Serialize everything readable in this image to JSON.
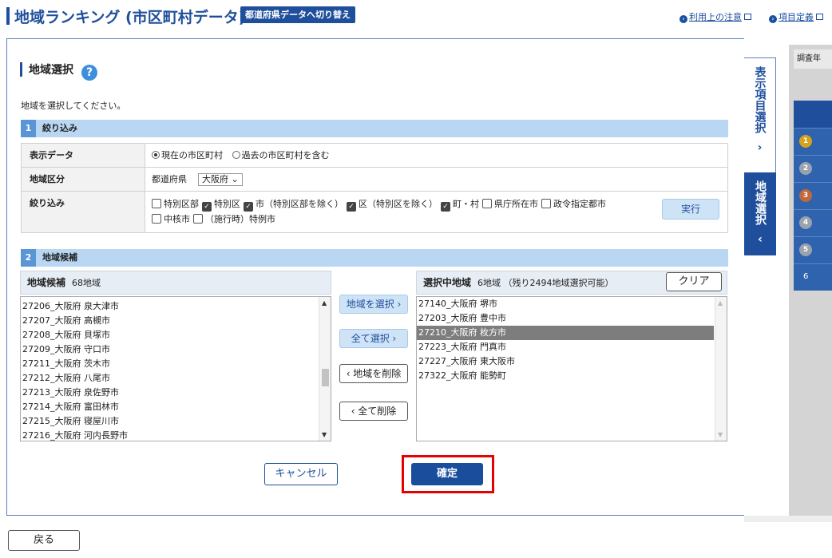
{
  "header": {
    "title": "地域ランキング (市区町村データ)",
    "switch_label": "都道府県データへ切り替え",
    "link_caution": "利用上の注意",
    "link_definition": "項目定義",
    "link_icon": "›"
  },
  "region_select": {
    "title": "地域選択",
    "help_label": "?",
    "instruction": "地域を選択してください。"
  },
  "step1": {
    "num": "1",
    "label": "絞り込み",
    "rows": {
      "display_data_label": "表示データ",
      "radio_current": "現在の市区町村",
      "radio_past": "過去の市区町村を含む",
      "region_category_label": "地域区分",
      "prefecture_label": "都道府県",
      "prefecture_value": "大阪府 ⌄",
      "filter_label": "絞り込み",
      "checkboxes": [
        {
          "label": "特別区部",
          "checked": false
        },
        {
          "label": "特別区",
          "checked": true
        },
        {
          "label": "市（特別区部を除く）",
          "checked": true
        },
        {
          "label": "区（特別区を除く）",
          "checked": true
        },
        {
          "label": "町・村",
          "checked": true
        },
        {
          "label": "県庁所在市",
          "checked": false
        },
        {
          "label": "政令指定都市",
          "checked": false
        },
        {
          "label": "中核市",
          "checked": false
        },
        {
          "label": "（施行時）特例市",
          "checked": false
        }
      ],
      "check_mark": "✓",
      "exec_label": "実行"
    }
  },
  "step2": {
    "num": "2",
    "label": "地域候補"
  },
  "candidates": {
    "title": "地域候補",
    "count": "68地域",
    "items": [
      "27206_大阪府 泉大津市",
      "27207_大阪府 高槻市",
      "27208_大阪府 貝塚市",
      "27209_大阪府 守口市",
      "27211_大阪府 茨木市",
      "27212_大阪府 八尾市",
      "27213_大阪府 泉佐野市",
      "27214_大阪府 富田林市",
      "27215_大阪府 寝屋川市",
      "27216_大阪府 河内長野市"
    ],
    "scroll_up": "▲",
    "scroll_down": "▼"
  },
  "selected": {
    "title": "選択中地域",
    "count": "6地域 （残り2494地域選択可能）",
    "clear_label": "クリア",
    "items": [
      "27140_大阪府 堺市",
      "27203_大阪府 豊中市",
      "27210_大阪府 枚方市",
      "27223_大阪府 門真市",
      "27227_大阪府 東大阪市",
      "27322_大阪府 能勢町"
    ],
    "highlighted_index": 2,
    "scroll_up": "▲",
    "scroll_down": "▼"
  },
  "middle_buttons": {
    "select_region": "地域を選択 ›",
    "select_all": "全て選択 ›",
    "delete_region": "‹ 地域を削除",
    "delete_all": "‹ 全て削除"
  },
  "actions": {
    "cancel": "キャンセル",
    "confirm": "確定",
    "back": "戻る"
  },
  "side_tabs": {
    "display_items": "表示項目選択",
    "display_items_arrow": "›",
    "region_select": "地域選択",
    "region_select_arrow": "‹",
    "survey_label": "調査年",
    "medals": [
      "1",
      "2",
      "3",
      "4",
      "5"
    ],
    "rank6": "6"
  },
  "colors": {
    "brand": "#1f4f9c",
    "highlight_border": "#e60000",
    "step_bar": "#b9d6f2"
  }
}
